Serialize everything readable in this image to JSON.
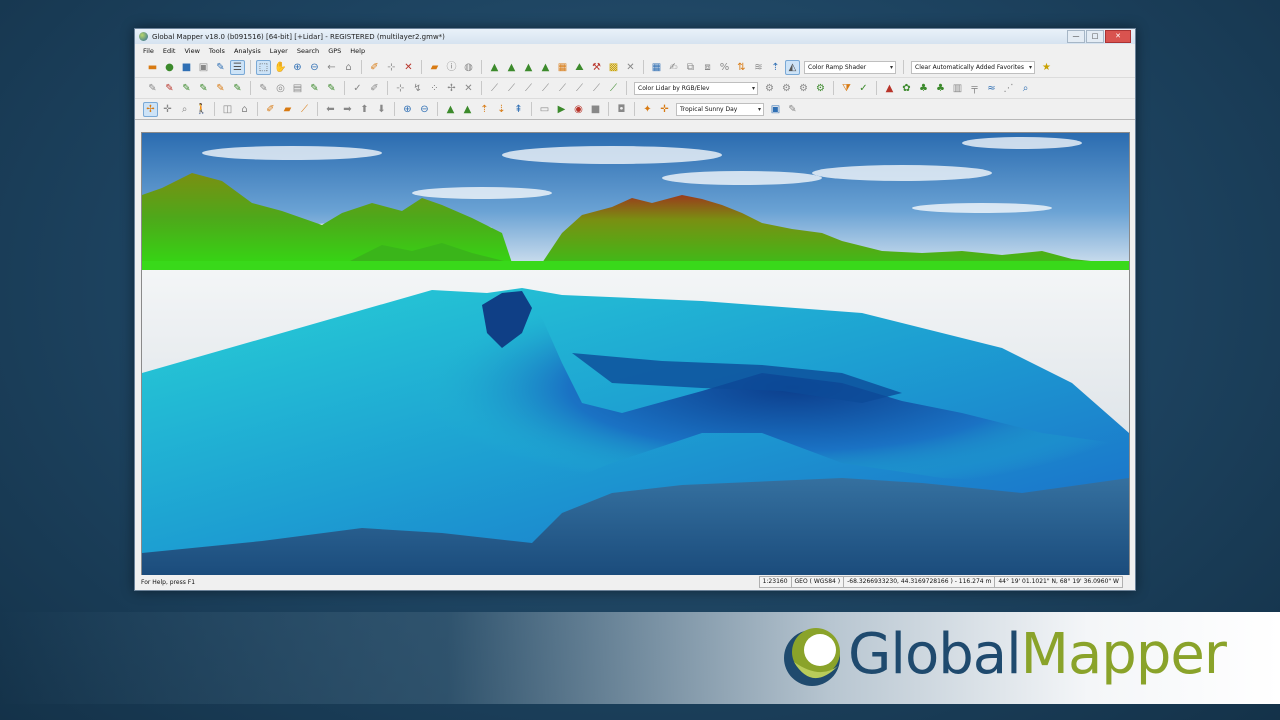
{
  "window": {
    "title": "Global Mapper v18.0 (b091516) [64-bit] [+Lidar] - REGISTERED (multilayer2.gmw*)",
    "buttons": {
      "minimize": "—",
      "maximize": "□",
      "close": "✕"
    }
  },
  "menu": [
    "File",
    "Edit",
    "View",
    "Tools",
    "Analysis",
    "Layer",
    "Search",
    "GPS",
    "Help"
  ],
  "toolbar1": {
    "shader_dropdown": "Color Ramp Shader",
    "favorites_dropdown": "Clear Automatically Added Favorites"
  },
  "toolbar2": {
    "lidar_dropdown": "Color Lidar by RGB/Elev"
  },
  "toolbar3": {
    "sky_dropdown": "Tropical Sunny Day"
  },
  "status": {
    "help": "For Help, press F1",
    "scale": "1:23160",
    "projection": "GEO ( WGS84 )",
    "coords": "-68.3266933230, 44.3169728166 ) - 116.274 m",
    "dms": "44° 19' 01.1021\" N, 68° 19' 36.0960\" W"
  },
  "logo": {
    "part1": "Global",
    "part2": "Mapper"
  },
  "colors": {
    "accent": "#8aa32a",
    "brand": "#1f4a6e",
    "terrain_green": "#4fbf1a",
    "water_cyan": "#1fc8d4"
  }
}
